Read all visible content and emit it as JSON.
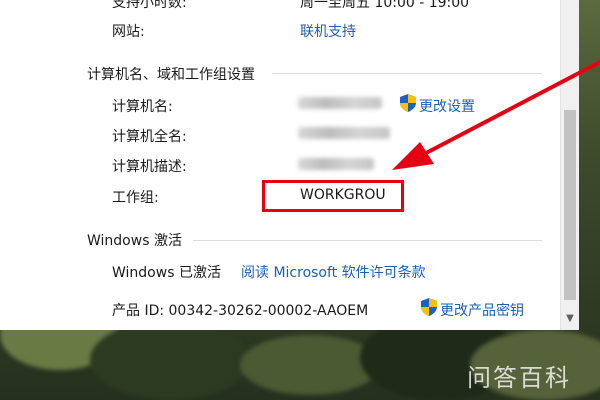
{
  "support": {
    "hours_label": "支持小时数:",
    "hours_value": "周一至周五 10:00 - 19:00",
    "website_label": "网站:",
    "website_link": "联机支持"
  },
  "computer": {
    "section_title": "计算机名、域和工作组设置",
    "name_label": "计算机名:",
    "full_name_label": "计算机全名:",
    "description_label": "计算机描述:",
    "workgroup_label": "工作组:",
    "workgroup_value": "WORKGROU",
    "change_settings": "更改设置"
  },
  "activation": {
    "section_title": "Windows 激活",
    "status": "Windows 已激活",
    "license_link": "阅读 Microsoft 软件许可条款",
    "product_id": "产品 ID: 00342-30262-00002-AAOEM",
    "change_key": "更改产品密钥"
  },
  "watermark": "问答百科",
  "colors": {
    "link": "#1a5fb4",
    "highlight": "#e60012",
    "arrow": "#e60012"
  }
}
